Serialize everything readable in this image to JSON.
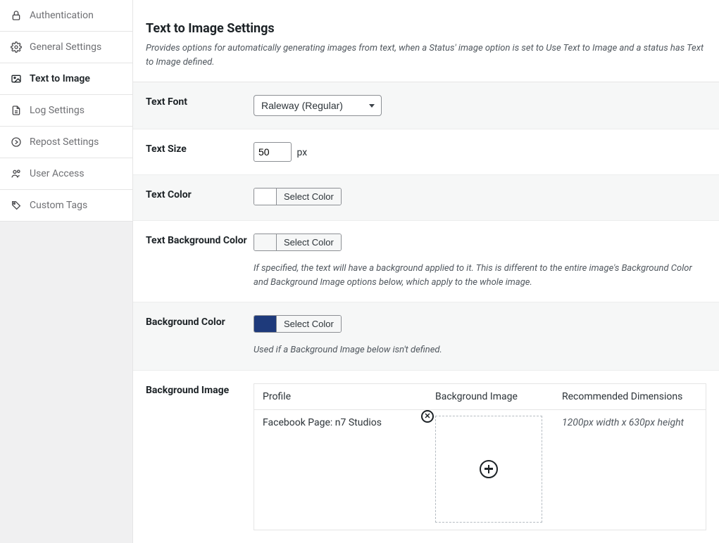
{
  "sidebar": {
    "items": [
      {
        "label": "Authentication"
      },
      {
        "label": "General Settings"
      },
      {
        "label": "Text to Image"
      },
      {
        "label": "Log Settings"
      },
      {
        "label": "Repost Settings"
      },
      {
        "label": "User Access"
      },
      {
        "label": "Custom Tags"
      }
    ]
  },
  "panel": {
    "title": "Text to Image Settings",
    "description": "Provides options for automatically generating images from text, when a Status' image option is set to Use Text to Image and a status has Text to Image defined."
  },
  "fields": {
    "text_font": {
      "label": "Text Font",
      "value": "Raleway (Regular)"
    },
    "text_size": {
      "label": "Text Size",
      "value": "50",
      "unit": "px"
    },
    "text_color": {
      "label": "Text Color",
      "button": "Select Color",
      "swatch": "#ffffff"
    },
    "text_bg_color": {
      "label": "Text Background Color",
      "button": "Select Color",
      "swatch": "#f6f7f7",
      "helper": "If specified, the text will have a background applied to it. This is different to the entire image's Background Color and Background Image options below, which apply to the whole image."
    },
    "bg_color": {
      "label": "Background Color",
      "button": "Select Color",
      "swatch": "#1e3a7b",
      "helper": "Used if a Background Image below isn't defined."
    },
    "bg_image": {
      "label": "Background Image",
      "headers": {
        "profile": "Profile",
        "image": "Background Image",
        "rec": "Recommended Dimensions"
      },
      "rows": [
        {
          "profile": "Facebook Page: n7 Studios",
          "rec": "1200px width x 630px height"
        }
      ]
    }
  }
}
